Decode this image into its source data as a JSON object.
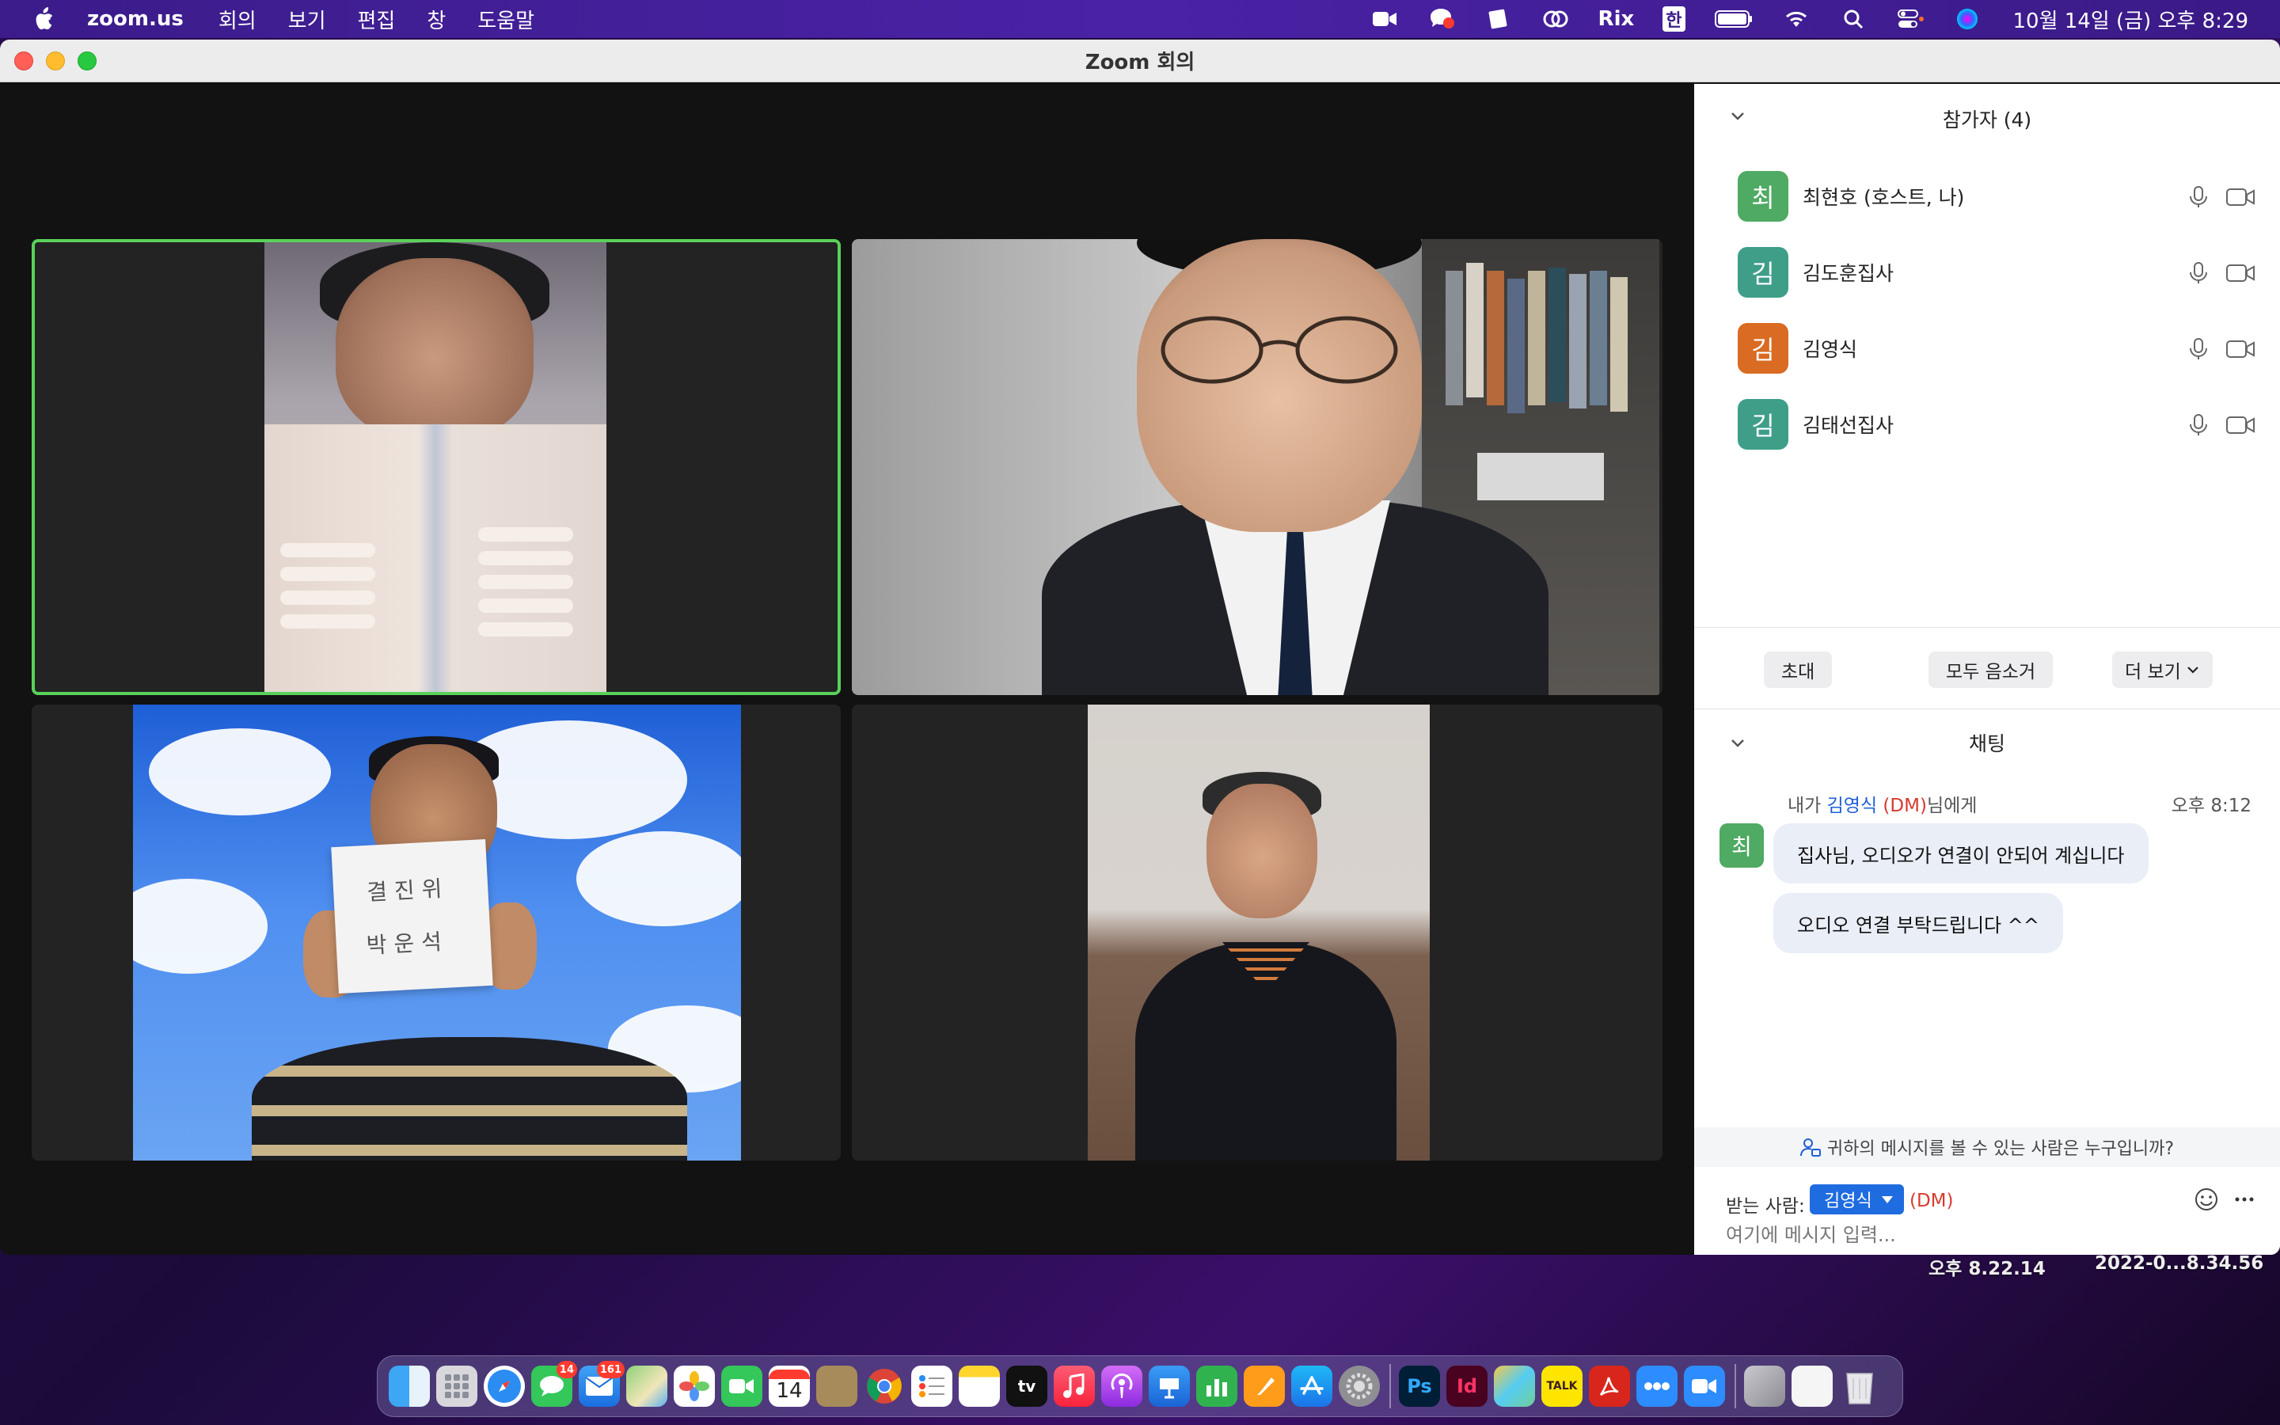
{
  "menubar": {
    "app_name": "zoom.us",
    "menus": [
      "회의",
      "보기",
      "편집",
      "창",
      "도움말"
    ],
    "status_rix": "Rix",
    "status_han": "한",
    "clock": "10월 14일 (금) 오후 8:29"
  },
  "window": {
    "title": "Zoom 회의"
  },
  "participants_panel": {
    "title": "참가자 (4)",
    "participants": [
      {
        "initial": "최",
        "name": "최현호 (호스트, 나)",
        "color": "#4faa63"
      },
      {
        "initial": "김",
        "name": "김도훈집사",
        "color": "#3e9e88"
      },
      {
        "initial": "김",
        "name": "김영식",
        "color": "#d96b22"
      },
      {
        "initial": "김",
        "name": "김태선집사",
        "color": "#3e9e88"
      }
    ],
    "invite_label": "초대",
    "mute_all_label": "모두 음소거",
    "more_label": "더 보기"
  },
  "chat_panel": {
    "title": "채팅",
    "message_meta_prefix": "내가 ",
    "message_meta_name": "김영식",
    "message_meta_dm": " (DM)",
    "message_meta_suffix": "님에게",
    "message_time": "오후 8:12",
    "sender_initial": "최",
    "messages": [
      "집사님, 오디오가 연결이 안되어 계십니다",
      "오디오 연결 부탁드립니다 ^^"
    ],
    "privacy_text": "귀하의 메시지를 볼 수 있는 사람은 누구입니까?",
    "to_label": "받는 사람:",
    "to_value": "김영식",
    "to_dm": "(DM)",
    "input_placeholder": "여기에 메시지 입력..."
  },
  "video_tiles": {
    "tile1_paper_text_1": "결 진 위",
    "tile1_paper_text_2": "박 운 석"
  },
  "desktop": {
    "file_label_1": "오후 8.22.14",
    "file_label_2": "2022-0...8.34.56"
  },
  "dock": {
    "mail_badge": "161",
    "messages_badge": "14",
    "calendar_day": "14",
    "appletv_label": "tv",
    "ps_label": "Ps",
    "id_label": "Id",
    "talk_label": "TALK"
  }
}
